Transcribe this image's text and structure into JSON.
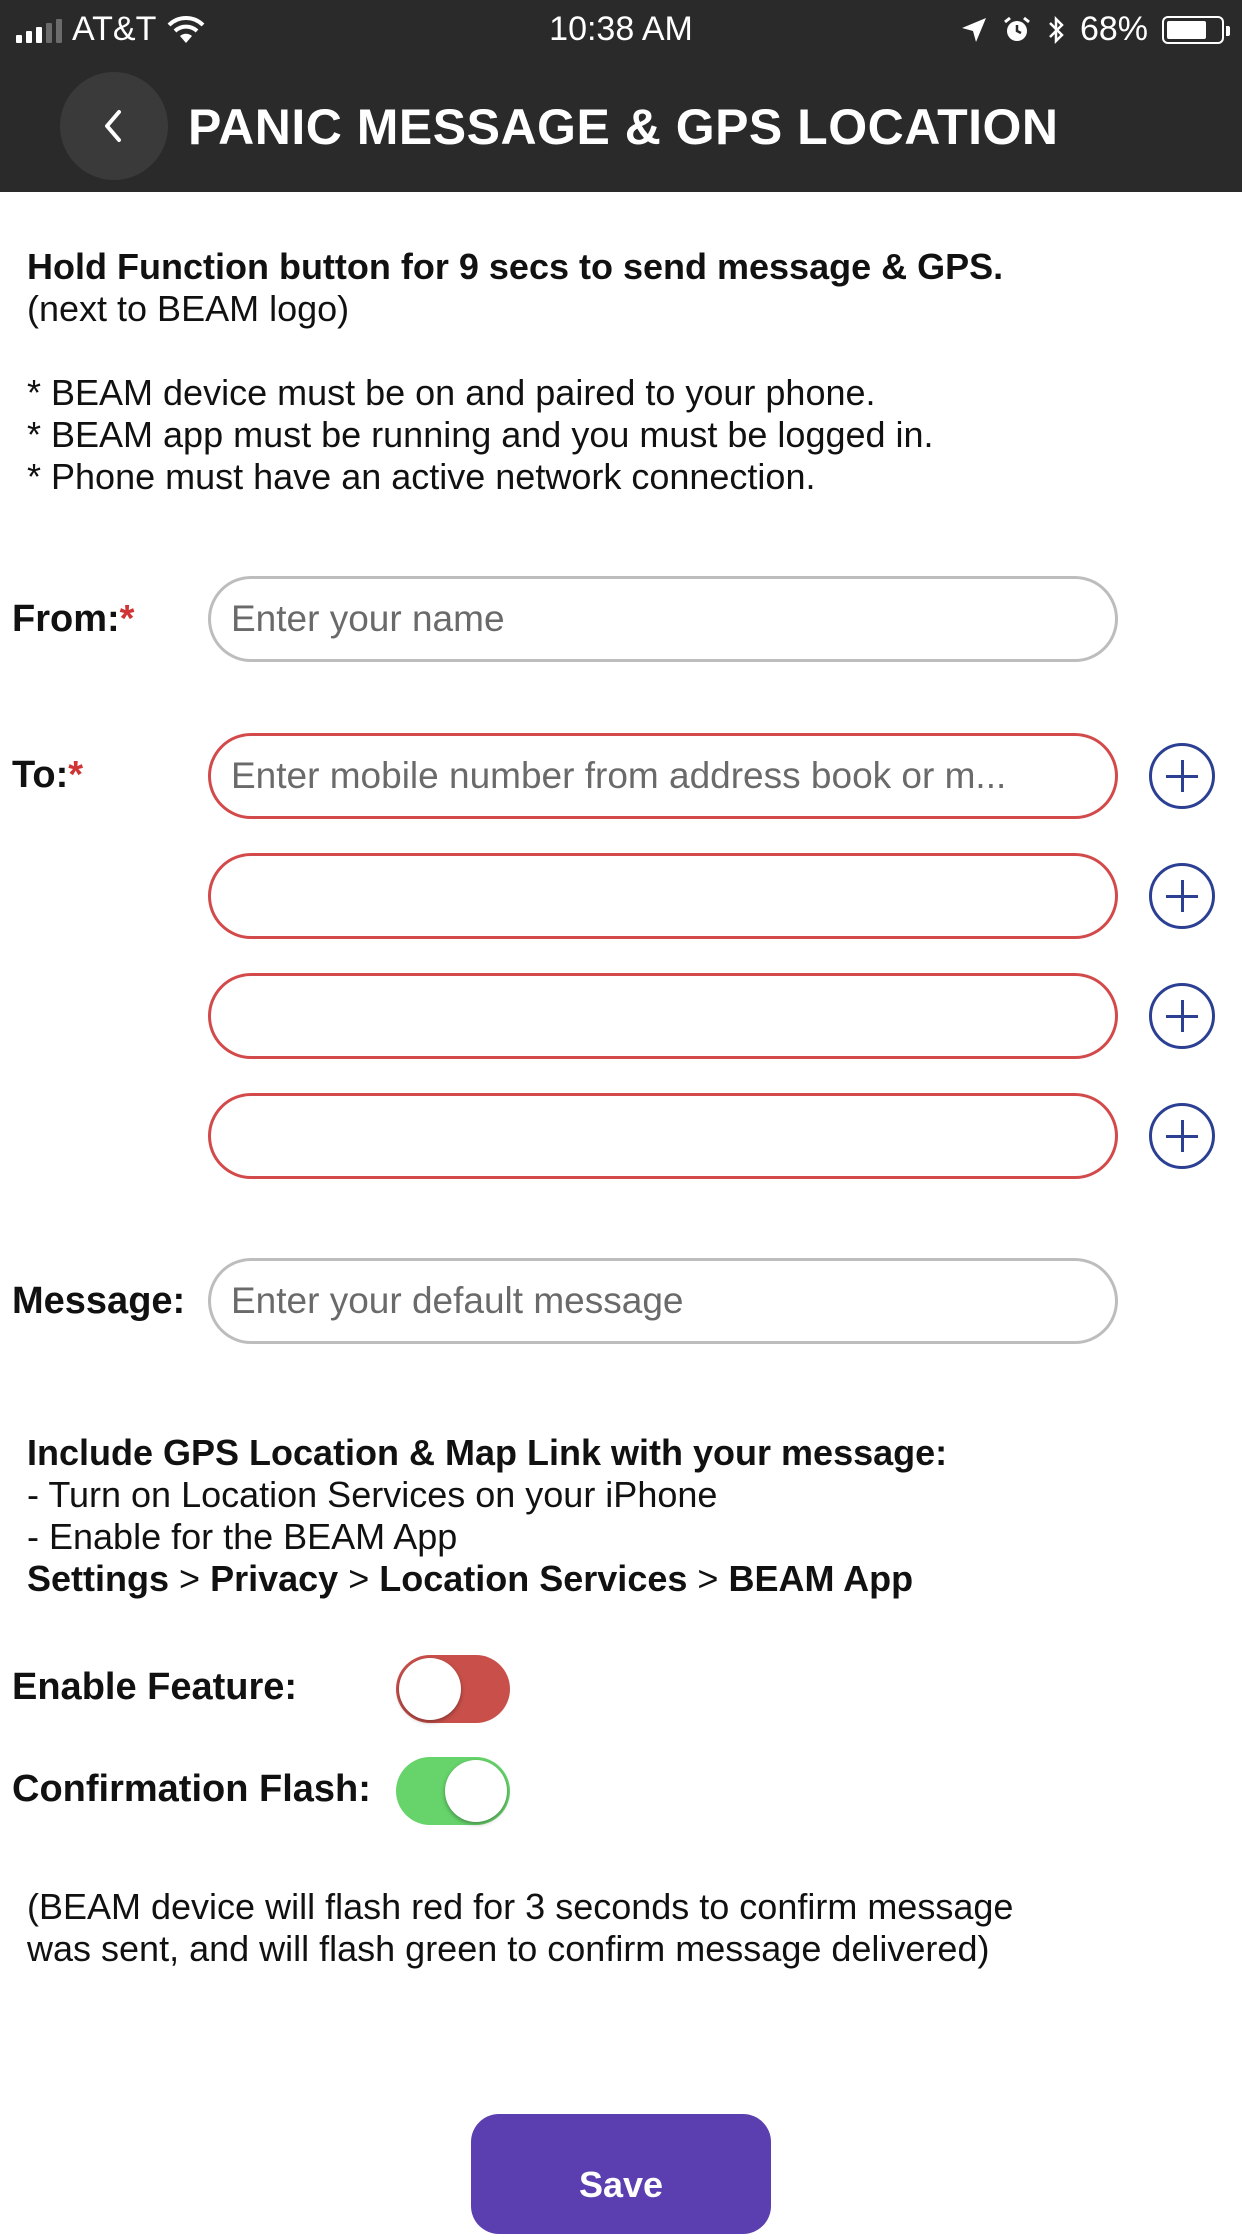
{
  "status_bar": {
    "carrier": "AT&T",
    "time": "10:38 AM",
    "battery": "68%",
    "battery_level": 0.68
  },
  "header": {
    "title": "PANIC MESSAGE & GPS LOCATION"
  },
  "intro": {
    "heading": "Hold Function button for 9 secs to send message & GPS.",
    "subheading": "(next to BEAM logo)",
    "requirements": [
      "* BEAM device must be on and paired to your phone.",
      "* BEAM app must be running and you must be logged in.",
      "* Phone must have an active network connection."
    ]
  },
  "form": {
    "from_label": "From:",
    "from_placeholder": "Enter your name",
    "to_label": "To:",
    "required_mark": "*",
    "to_placeholder": "Enter mobile number from address book or m...",
    "message_label": "Message:",
    "message_placeholder": "Enter your default message"
  },
  "gps": {
    "heading": "Include GPS Location & Map Link with your message:",
    "steps": [
      "- Turn on Location Services on your iPhone",
      "- Enable for the BEAM App"
    ],
    "path": [
      "Settings",
      "Privacy",
      "Location Services",
      "BEAM App"
    ],
    "separator": ">"
  },
  "toggles": {
    "enable_feature_label": "Enable Feature:",
    "enable_feature_on": false,
    "confirmation_flash_label": "Confirmation Flash:",
    "confirmation_flash_on": true
  },
  "note": {
    "line1": "(BEAM device will flash red for 3 seconds to confirm message",
    "line2": "was sent, and will flash green to confirm message delivered)"
  },
  "save_button": {
    "label": "Save"
  },
  "colors": {
    "header_bg": "#2a2a2a",
    "required_red": "#d03434",
    "field_error_border": "#d24a4a",
    "add_icon_blue": "#2b3f93",
    "toggle_off": "#c9504a",
    "toggle_on": "#67d46b",
    "save_purple": "#5b3fb0"
  }
}
